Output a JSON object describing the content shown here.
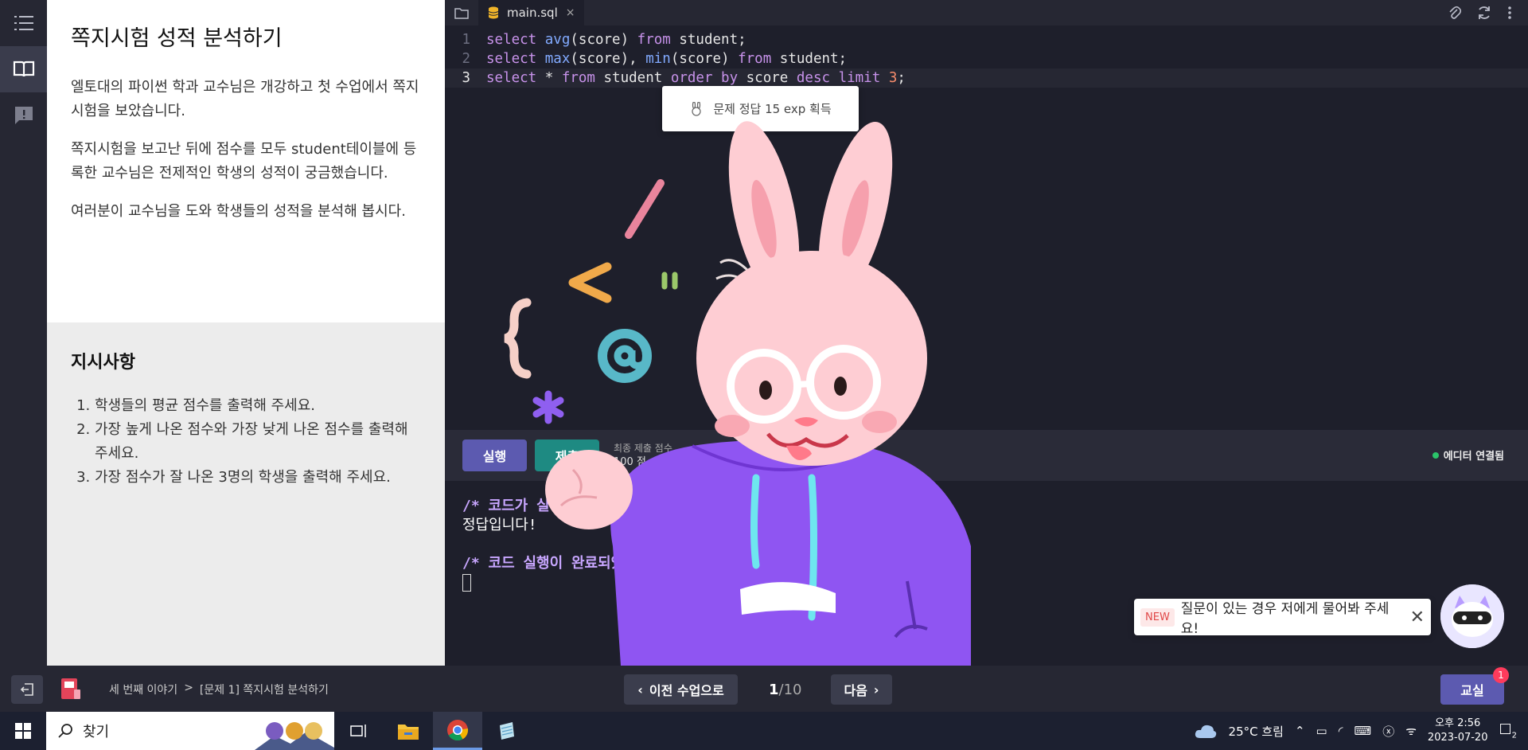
{
  "instructions": {
    "title": "쪽지시험 성적 분석하기",
    "paragraphs": [
      "엘토대의 파이썬 학과 교수님은 개강하고 첫 수업에서 쪽지시험을 보았습니다.",
      "쪽지시험을 보고난 뒤에 점수를 모두 student테이블에 등록한 교수님은 전제적인 학생의 성적이 궁금했습니다.",
      "여러분이 교수님을 도와 학생들의 성적을 분석해 봅시다."
    ],
    "subtitle": "지시사항",
    "steps": [
      "학생들의 평균 점수를 출력해 주세요.",
      "가장 높게 나온 점수와 가장 낮게 나온 점수를 출력해 주세요.",
      "가장 점수가 잘 나온 3명의 학생을 출력해 주세요."
    ]
  },
  "editor": {
    "tab_name": "main.sql",
    "tab_close": "×",
    "line_numbers": [
      "1",
      "2",
      "3"
    ]
  },
  "toast": {
    "text": "문제 정답 15 exp 획득"
  },
  "actions": {
    "run_label": "실행",
    "submit_label": "제출",
    "score_label": "최종 제출 점수",
    "score_value": "100 점",
    "connection": "에디터 연결됨"
  },
  "terminal": {
    "line1": "/* 코드가 실행되었습니다... */",
    "line2": "정답입니다!",
    "line3": "/* 코드 실행이 완료되었습니다. */"
  },
  "chat": {
    "badge": "NEW",
    "text": "질문이 있는 경우 저에게 물어봐 주세요!",
    "close": "✕"
  },
  "navbar": {
    "breadcrumb": [
      "세 번째 이야기",
      ">",
      "[문제 1] 쪽지시험 분석하기"
    ],
    "prev_label": "이전 수업으로",
    "page_current": "1",
    "page_total": "/10",
    "next_label": "다음",
    "class_label": "교실",
    "class_badge": "1"
  },
  "taskbar": {
    "search_label": "찾기",
    "weather": "25°C 흐림",
    "time": "오후 2:56",
    "date": "2023-07-20",
    "notif_count": "2"
  },
  "colors": {
    "keyword": "#c792ea",
    "function": "#82aaff",
    "number": "#f78c6c",
    "run": "#5c5ab0",
    "submit": "#1e8a82"
  }
}
